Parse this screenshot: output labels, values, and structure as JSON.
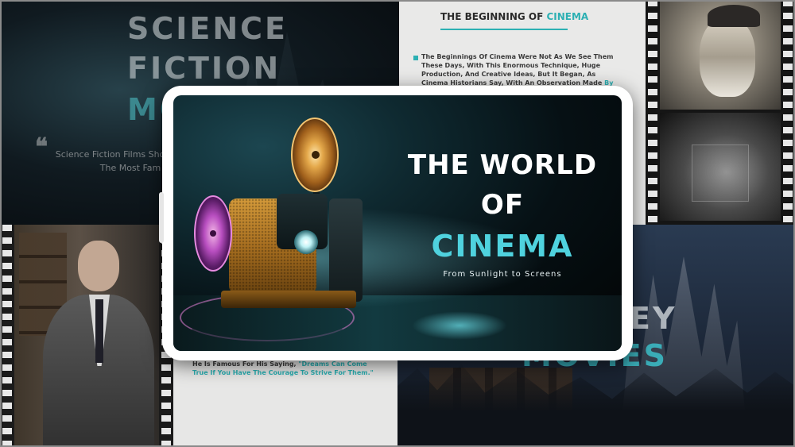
{
  "panels": {
    "scifi": {
      "heading_line1": "SCIENCE",
      "heading_line2": "FICTION",
      "heading_line3": "MO",
      "quote_mark": "❝",
      "quote": "Science Fiction Films Show One Of The Most Fam"
    },
    "doc_top": {
      "title_prefix": "THE BEGINNING OF ",
      "title_accent": "CINEMA",
      "body": "The Beginnings Of Cinema Were Not As We See Them These Days, With This Enormous Technique, Huge Production, And Creative Ideas, But It Began, As Cinema Historians Say, With An Observation Made ",
      "body_accent": "By Leonardo"
    },
    "doc_bottom": {
      "body": "He Is Famous For His Saying, ",
      "body_accent": "\"Dreams Can Come True If You Have The Courage To Strive For Them.\""
    },
    "disney": {
      "word1": "EY",
      "word2": "MOVIES"
    }
  },
  "tablet": {
    "title_line1": "THE WORLD",
    "title_line2": "OF",
    "title_line3": "CINEMA",
    "subtitle": "From Sunlight to Screens"
  },
  "colors": {
    "accent": "#4fd2de",
    "doc_accent": "#2cb0b3",
    "tablet_frame": "#ffffff"
  },
  "icons": [
    "projector-illustration",
    "film-reel-icon",
    "quote-mark-icon"
  ]
}
